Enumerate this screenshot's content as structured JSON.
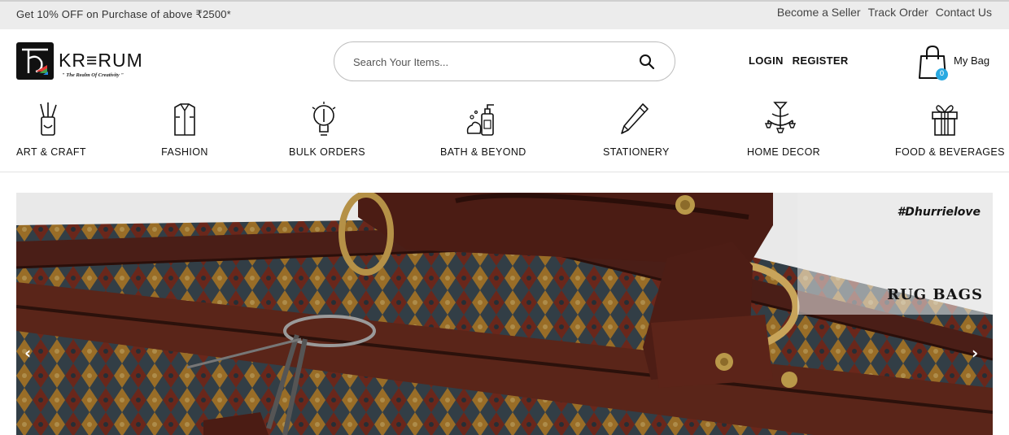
{
  "topbar": {
    "promo": "Get 10% OFF on Purchase of above ₹2500*",
    "links": [
      "Become a Seller",
      "Track Order",
      "Contact Us"
    ]
  },
  "header": {
    "logo_name": "KR≡RUM",
    "logo_tagline": "\" The Realm Of Creativity \"",
    "search_placeholder": "Search Your Items...",
    "login": "LOGIN",
    "register": "REGISTER",
    "bag_label": "My Bag",
    "bag_count": "0"
  },
  "categories": [
    {
      "label": "ART & CRAFT",
      "icon": "paint-brushes-icon"
    },
    {
      "label": "FASHION",
      "icon": "shirt-icon"
    },
    {
      "label": "BULK ORDERS",
      "icon": "light-bulb-icon"
    },
    {
      "label": "BATH & BEYOND",
      "icon": "soap-dispenser-icon"
    },
    {
      "label": "STATIONERY",
      "icon": "pen-icon"
    },
    {
      "label": "HOME DECOR",
      "icon": "chandelier-icon"
    },
    {
      "label": "FOOD & BEVERAGES",
      "icon": "gift-box-icon"
    }
  ],
  "banner": {
    "hashtag": "#Dhurrielove",
    "headline": "RUG BAGS",
    "prev_arrow": "‹",
    "next_arrow": "›"
  },
  "colors": {
    "accent": "#29a9e1",
    "topbar_bg": "#ececec",
    "leather": "#4a1e17"
  }
}
